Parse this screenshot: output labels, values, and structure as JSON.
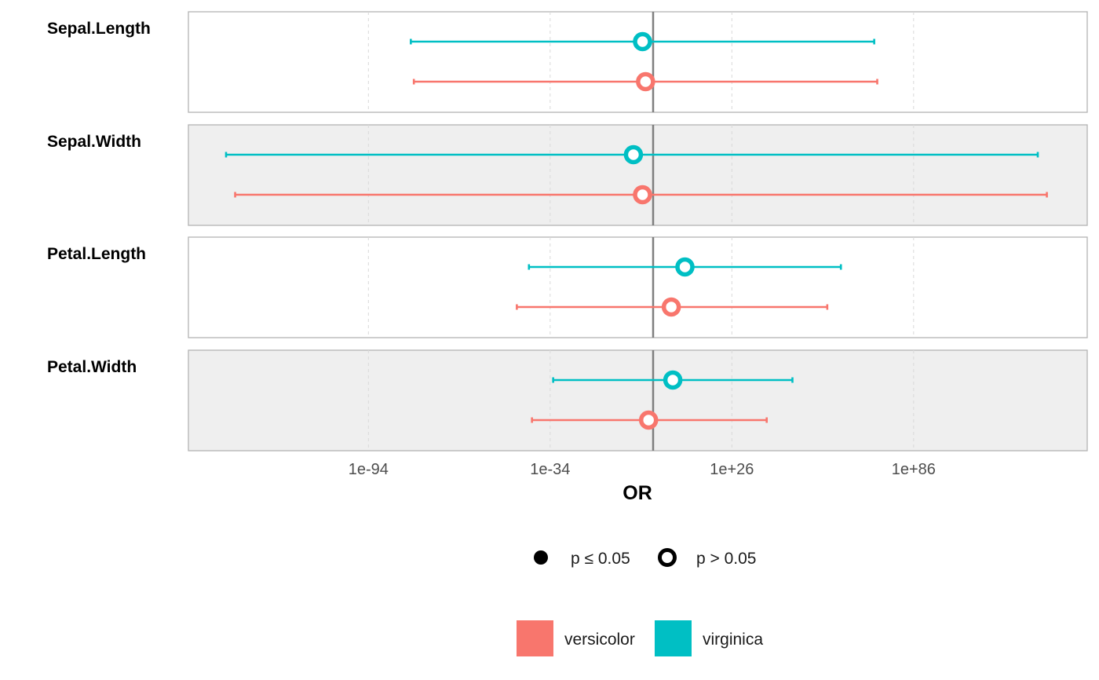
{
  "chart_data": {
    "type": "forest",
    "xlabel": "OR",
    "x_scale": "log10",
    "x_range_log10": [
      -150,
      147
    ],
    "x_ticks": [
      {
        "log10": -94,
        "label": "1e-94"
      },
      {
        "log10": -34,
        "label": "1e-34"
      },
      {
        "log10": 26,
        "label": "1e+26"
      },
      {
        "log10": 86,
        "label": "1e+86"
      }
    ],
    "reference_line_log10": 0,
    "grid": true,
    "series": [
      {
        "name": "versicolor",
        "color": "#F8766D"
      },
      {
        "name": "virginica",
        "color": "#00BFC4"
      }
    ],
    "rows": [
      {
        "label": "Sepal.Length",
        "shaded": false,
        "estimates": [
          {
            "series": "virginica",
            "est": -3.5,
            "lo": -80,
            "hi": 73,
            "p_gt_005": true
          },
          {
            "series": "versicolor",
            "est": -2.5,
            "lo": -79,
            "hi": 74,
            "p_gt_005": true
          }
        ]
      },
      {
        "label": "Sepal.Width",
        "shaded": true,
        "estimates": [
          {
            "series": "virginica",
            "est": -6.5,
            "lo": -141,
            "hi": 127,
            "p_gt_005": true
          },
          {
            "series": "versicolor",
            "est": -3.5,
            "lo": -138,
            "hi": 130,
            "p_gt_005": true
          }
        ]
      },
      {
        "label": "Petal.Length",
        "shaded": false,
        "estimates": [
          {
            "series": "virginica",
            "est": 10.5,
            "lo": -41,
            "hi": 62,
            "p_gt_005": true
          },
          {
            "series": "versicolor",
            "est": 6,
            "lo": -45,
            "hi": 57.5,
            "p_gt_005": true
          }
        ]
      },
      {
        "label": "Petal.Width",
        "shaded": true,
        "estimates": [
          {
            "series": "virginica",
            "est": 6.5,
            "lo": -33,
            "hi": 46,
            "p_gt_005": true
          },
          {
            "series": "versicolor",
            "est": -1.5,
            "lo": -40,
            "hi": 37.5,
            "p_gt_005": true
          }
        ]
      }
    ],
    "legend": {
      "placement": "bottom",
      "shapes": [
        {
          "label": "p ≤ 0.05",
          "filled": true
        },
        {
          "label": "p > 0.05",
          "filled": false
        }
      ],
      "colors": [
        {
          "label": "versicolor",
          "color": "#F8766D"
        },
        {
          "label": "virginica",
          "color": "#00BFC4"
        }
      ]
    }
  }
}
